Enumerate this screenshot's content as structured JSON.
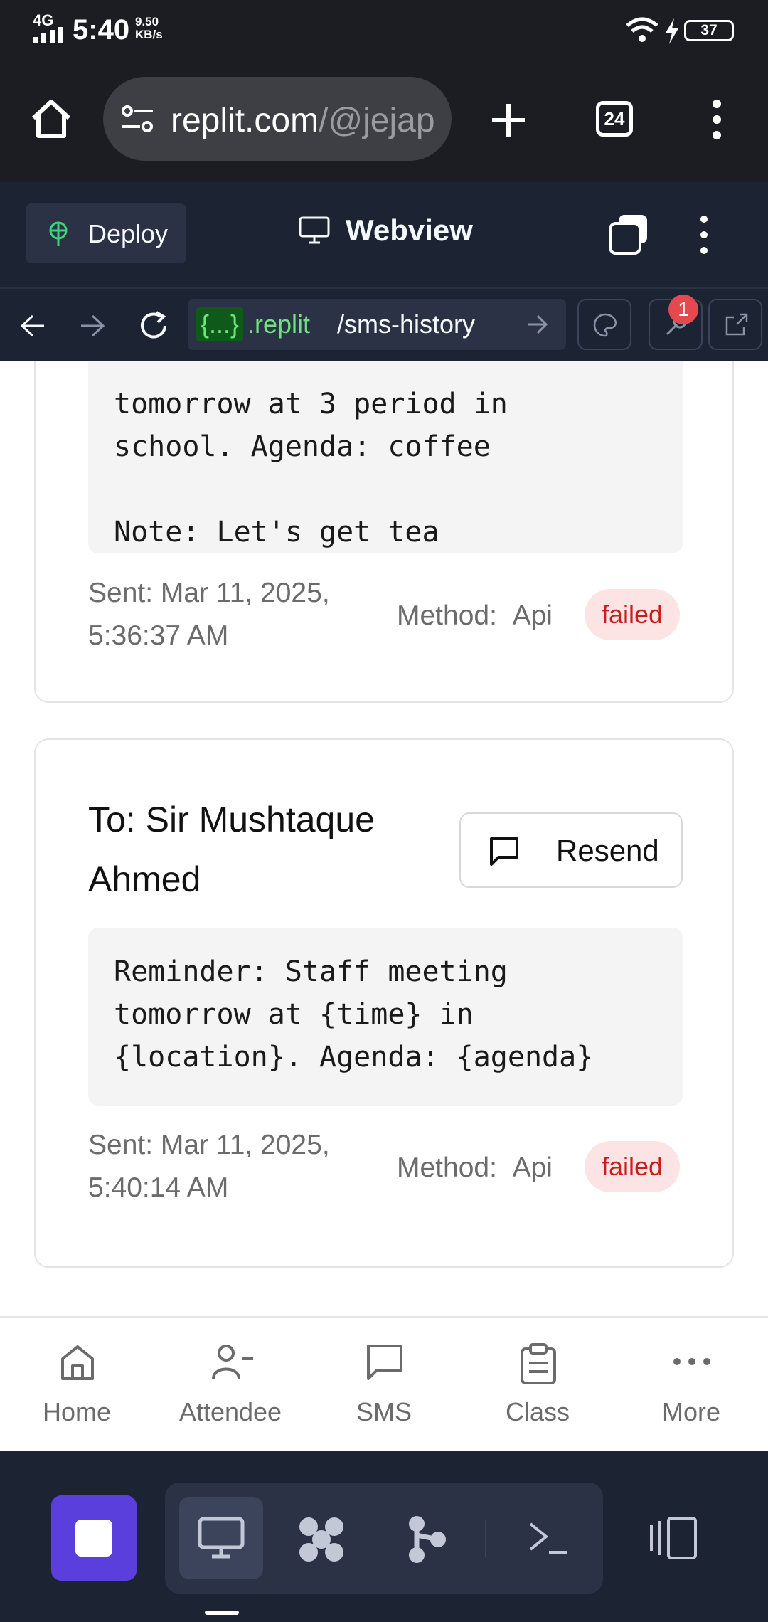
{
  "status_bar": {
    "network": "4G",
    "time": "5:40",
    "speed_value": "9.50",
    "speed_unit": "KB/s",
    "battery": "37"
  },
  "browser": {
    "url_main": "replit.com",
    "url_dim": "/@jejap",
    "tab_count": "24"
  },
  "replit": {
    "deploy_label": "Deploy",
    "webview_label": "Webview",
    "url_tag": "{...}",
    "url_domain": ".replit",
    "url_path": "/sms-history",
    "notification_count": "1"
  },
  "sms_history": [
    {
      "message": "tomorrow at 3 period in\nschool. Agenda: coffee\n\nNote: Let's get tea",
      "sent": "Sent: Mar 11, 2025, 5:36:37 AM",
      "method_label": "Method:",
      "method": "Api",
      "status": "failed"
    },
    {
      "to": "To: Sir Mushtaque Ahmed",
      "resend_label": "Resend",
      "message": "Reminder: Staff meeting\ntomorrow at {time} in\n{location}. Agenda: {agenda}",
      "sent": "Sent: Mar 11, 2025, 5:40:14 AM",
      "method_label": "Method:",
      "method": "Api",
      "status": "failed"
    }
  ],
  "bottom_nav": [
    {
      "label": "Home",
      "icon": "home-icon"
    },
    {
      "label": "Attendee",
      "icon": "user-minus-icon"
    },
    {
      "label": "SMS",
      "icon": "message-square-icon"
    },
    {
      "label": "Class",
      "icon": "clipboard-icon"
    },
    {
      "label": "More",
      "icon": "more-horizontal-icon"
    }
  ],
  "colors": {
    "failed_bg": "#fde4e4",
    "failed_text": "#c81e1e",
    "run_button": "#5b3fdc",
    "replit_bg": "#1c2333"
  }
}
